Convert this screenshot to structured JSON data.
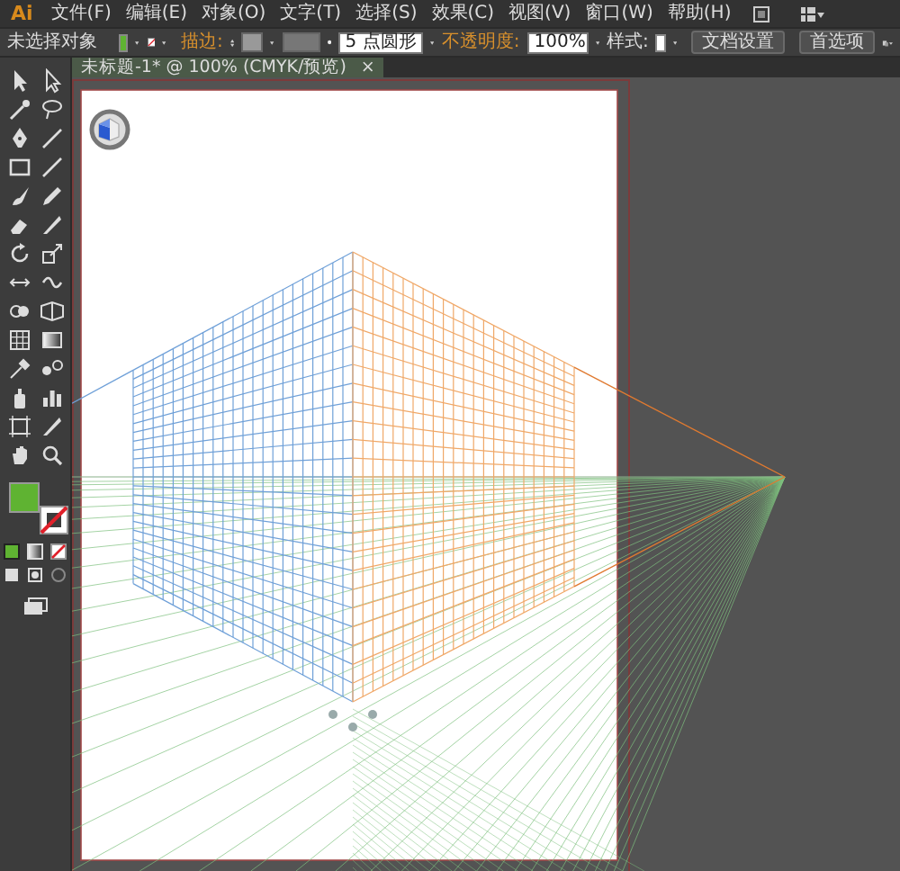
{
  "app_logo": "Ai",
  "menu": [
    "文件(F)",
    "编辑(E)",
    "对象(O)",
    "文字(T)",
    "选择(S)",
    "效果(C)",
    "视图(V)",
    "窗口(W)",
    "帮助(H)"
  ],
  "control_bar": {
    "selection_label": "未选择对象",
    "stroke_label": "描边:",
    "brush_dropdown": "5 点圆形",
    "opacity_label": "不透明度:",
    "opacity_value": "100%",
    "style_label": "样式:",
    "buttons": [
      "文档设置",
      "首选项"
    ]
  },
  "document_tab": {
    "title": "未标题-1* @ 100% (CMYK/预览)",
    "close": "×"
  }
}
